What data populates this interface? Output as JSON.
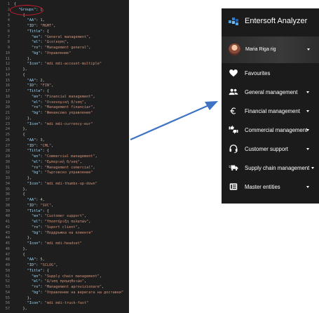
{
  "editor": {
    "lines": [
      {
        "n": "1",
        "parts": [
          [
            "p",
            "{"
          ]
        ]
      },
      {
        "n": "2",
        "parts": [
          [
            "p",
            "  "
          ],
          [
            "k",
            "\"Groups\""
          ],
          [
            "p",
            ": ["
          ]
        ]
      },
      {
        "n": "3",
        "parts": [
          [
            "p",
            "    {"
          ]
        ]
      },
      {
        "n": "4",
        "parts": [
          [
            "p",
            "      "
          ],
          [
            "k",
            "\"AA\""
          ],
          [
            "p",
            ": "
          ],
          [
            "n",
            "1"
          ],
          [
            "p",
            ","
          ]
        ]
      },
      {
        "n": "5",
        "parts": [
          [
            "p",
            "      "
          ],
          [
            "k",
            "\"ID\""
          ],
          [
            "p",
            ": "
          ],
          [
            "s",
            "\"MGMT\""
          ],
          [
            "p",
            ","
          ]
        ]
      },
      {
        "n": "6",
        "parts": [
          [
            "p",
            "      "
          ],
          [
            "k",
            "\"Title\""
          ],
          [
            "p",
            ": {"
          ]
        ]
      },
      {
        "n": "7",
        "parts": [
          [
            "p",
            "        "
          ],
          [
            "k",
            "\"en\""
          ],
          [
            "p",
            ": "
          ],
          [
            "s",
            "\"General management\""
          ],
          [
            "p",
            ","
          ]
        ]
      },
      {
        "n": "8",
        "parts": [
          [
            "p",
            "        "
          ],
          [
            "k",
            "\"el\""
          ],
          [
            "p",
            ": "
          ],
          [
            "s",
            "\"Διοίκηση\""
          ],
          [
            "p",
            ","
          ]
        ]
      },
      {
        "n": "9",
        "parts": [
          [
            "p",
            "        "
          ],
          [
            "k",
            "\"ro\""
          ],
          [
            "p",
            ": "
          ],
          [
            "s",
            "\"Management general\""
          ],
          [
            "p",
            ","
          ]
        ]
      },
      {
        "n": "10",
        "parts": [
          [
            "p",
            "        "
          ],
          [
            "k",
            "\"bg\""
          ],
          [
            "p",
            ": "
          ],
          [
            "s",
            "\"Управление\""
          ]
        ]
      },
      {
        "n": "11",
        "parts": [
          [
            "p",
            "      },"
          ]
        ]
      },
      {
        "n": "12",
        "parts": [
          [
            "p",
            "      "
          ],
          [
            "k",
            "\"Icon\""
          ],
          [
            "p",
            ": "
          ],
          [
            "s",
            "\"mdi mdi-account-multiple\""
          ]
        ]
      },
      {
        "n": "13",
        "parts": [
          [
            "p",
            "    },"
          ]
        ]
      },
      {
        "n": "14",
        "parts": [
          [
            "p",
            "    {"
          ]
        ]
      },
      {
        "n": "15",
        "parts": [
          [
            "p",
            "      "
          ],
          [
            "k",
            "\"AA\""
          ],
          [
            "p",
            ": "
          ],
          [
            "n",
            "2"
          ],
          [
            "p",
            ","
          ]
        ]
      },
      {
        "n": "16",
        "parts": [
          [
            "p",
            "      "
          ],
          [
            "k",
            "\"ID\""
          ],
          [
            "p",
            ": "
          ],
          [
            "s",
            "\"FIN\""
          ],
          [
            "p",
            ","
          ]
        ]
      },
      {
        "n": "17",
        "parts": [
          [
            "p",
            "      "
          ],
          [
            "k",
            "\"Title\""
          ],
          [
            "p",
            ": {"
          ]
        ]
      },
      {
        "n": "18",
        "parts": [
          [
            "p",
            "        "
          ],
          [
            "k",
            "\"en\""
          ],
          [
            "p",
            ": "
          ],
          [
            "s",
            "\"Financial management\""
          ],
          [
            "p",
            ","
          ]
        ]
      },
      {
        "n": "19",
        "parts": [
          [
            "p",
            "        "
          ],
          [
            "k",
            "\"el\""
          ],
          [
            "p",
            ": "
          ],
          [
            "s",
            "\"Οικονομική δ/νση\""
          ],
          [
            "p",
            ","
          ]
        ]
      },
      {
        "n": "20",
        "parts": [
          [
            "p",
            "        "
          ],
          [
            "k",
            "\"ro\""
          ],
          [
            "p",
            ": "
          ],
          [
            "s",
            "\"Management financiar\""
          ],
          [
            "p",
            ","
          ]
        ]
      },
      {
        "n": "21",
        "parts": [
          [
            "p",
            "        "
          ],
          [
            "k",
            "\"bg\""
          ],
          [
            "p",
            ": "
          ],
          [
            "s",
            "\"Финансово управление\""
          ]
        ]
      },
      {
        "n": "22",
        "parts": [
          [
            "p",
            "      },"
          ]
        ]
      },
      {
        "n": "23",
        "parts": [
          [
            "p",
            "      "
          ],
          [
            "k",
            "\"Icon\""
          ],
          [
            "p",
            ": "
          ],
          [
            "s",
            "\"mdi mdi-currency-eur\""
          ]
        ]
      },
      {
        "n": "24",
        "parts": [
          [
            "p",
            "    },"
          ]
        ]
      },
      {
        "n": "25",
        "parts": [
          [
            "p",
            "    {"
          ]
        ]
      },
      {
        "n": "26",
        "parts": [
          [
            "p",
            "      "
          ],
          [
            "k",
            "\"AA\""
          ],
          [
            "p",
            ": "
          ],
          [
            "n",
            "3"
          ],
          [
            "p",
            ","
          ]
        ]
      },
      {
        "n": "27",
        "parts": [
          [
            "p",
            "      "
          ],
          [
            "k",
            "\"ID\""
          ],
          [
            "p",
            ": "
          ],
          [
            "s",
            "\"CML\""
          ],
          [
            "p",
            ","
          ]
        ]
      },
      {
        "n": "28",
        "parts": [
          [
            "p",
            "      "
          ],
          [
            "k",
            "\"Title\""
          ],
          [
            "p",
            ": {"
          ]
        ]
      },
      {
        "n": "29",
        "parts": [
          [
            "p",
            "        "
          ],
          [
            "k",
            "\"en\""
          ],
          [
            "p",
            ": "
          ],
          [
            "s",
            "\"Commercial management\""
          ],
          [
            "p",
            ","
          ]
        ]
      },
      {
        "n": "30",
        "parts": [
          [
            "p",
            "        "
          ],
          [
            "k",
            "\"el\""
          ],
          [
            "p",
            ": "
          ],
          [
            "s",
            "\"Εμπορική δ/νση\""
          ],
          [
            "p",
            ","
          ]
        ]
      },
      {
        "n": "31",
        "parts": [
          [
            "p",
            "        "
          ],
          [
            "k",
            "\"ro\""
          ],
          [
            "p",
            ": "
          ],
          [
            "s",
            "\"Management comercial\""
          ],
          [
            "p",
            ","
          ]
        ]
      },
      {
        "n": "32",
        "parts": [
          [
            "p",
            "        "
          ],
          [
            "k",
            "\"bg\""
          ],
          [
            "p",
            ": "
          ],
          [
            "s",
            "\"Търговско управление\""
          ]
        ]
      },
      {
        "n": "33",
        "parts": [
          [
            "p",
            "      },"
          ]
        ]
      },
      {
        "n": "34",
        "parts": [
          [
            "p",
            "      "
          ],
          [
            "k",
            "\"Icon\""
          ],
          [
            "p",
            ": "
          ],
          [
            "s",
            "\"mdi mdi-thumbs-up-down\""
          ]
        ]
      },
      {
        "n": "35",
        "parts": [
          [
            "p",
            "    },"
          ]
        ]
      },
      {
        "n": "36",
        "parts": [
          [
            "p",
            "    {"
          ]
        ]
      },
      {
        "n": "37",
        "parts": [
          [
            "p",
            "      "
          ],
          [
            "k",
            "\"AA\""
          ],
          [
            "p",
            ": "
          ],
          [
            "n",
            "4"
          ],
          [
            "p",
            ","
          ]
        ]
      },
      {
        "n": "38",
        "parts": [
          [
            "p",
            "      "
          ],
          [
            "k",
            "\"ID\""
          ],
          [
            "p",
            ": "
          ],
          [
            "s",
            "\"SVC\""
          ],
          [
            "p",
            ","
          ]
        ]
      },
      {
        "n": "39",
        "parts": [
          [
            "p",
            "      "
          ],
          [
            "k",
            "\"Title\""
          ],
          [
            "p",
            ": {"
          ]
        ]
      },
      {
        "n": "40",
        "parts": [
          [
            "p",
            "        "
          ],
          [
            "k",
            "\"en\""
          ],
          [
            "p",
            ": "
          ],
          [
            "s",
            "\"Customer support\""
          ],
          [
            "p",
            ","
          ]
        ]
      },
      {
        "n": "41",
        "parts": [
          [
            "p",
            "        "
          ],
          [
            "k",
            "\"el\""
          ],
          [
            "p",
            ": "
          ],
          [
            "s",
            "\"Υποστήριξη πελατών\""
          ],
          [
            "p",
            ","
          ]
        ]
      },
      {
        "n": "42",
        "parts": [
          [
            "p",
            "        "
          ],
          [
            "k",
            "\"ro\""
          ],
          [
            "p",
            ": "
          ],
          [
            "s",
            "\"Suport client\""
          ],
          [
            "p",
            ","
          ]
        ]
      },
      {
        "n": "43",
        "parts": [
          [
            "p",
            "        "
          ],
          [
            "k",
            "\"bg\""
          ],
          [
            "p",
            ": "
          ],
          [
            "s",
            "\"Поддръжка на клиенти\""
          ]
        ]
      },
      {
        "n": "44",
        "parts": [
          [
            "p",
            "      },"
          ]
        ]
      },
      {
        "n": "45",
        "parts": [
          [
            "p",
            "      "
          ],
          [
            "k",
            "\"Icon\""
          ],
          [
            "p",
            ": "
          ],
          [
            "s",
            "\"mdi mdi-headset\""
          ]
        ]
      },
      {
        "n": "46",
        "parts": [
          [
            "p",
            "    },"
          ]
        ]
      },
      {
        "n": "47",
        "parts": [
          [
            "p",
            "    {"
          ]
        ]
      },
      {
        "n": "48",
        "parts": [
          [
            "p",
            "      "
          ],
          [
            "k",
            "\"AA\""
          ],
          [
            "p",
            ": "
          ],
          [
            "n",
            "5"
          ],
          [
            "p",
            ","
          ]
        ]
      },
      {
        "n": "49",
        "parts": [
          [
            "p",
            "      "
          ],
          [
            "k",
            "\"ID\""
          ],
          [
            "p",
            ": "
          ],
          [
            "s",
            "\"SCLOG\""
          ],
          [
            "p",
            ","
          ]
        ]
      },
      {
        "n": "50",
        "parts": [
          [
            "p",
            "      "
          ],
          [
            "k",
            "\"Title\""
          ],
          [
            "p",
            ": {"
          ]
        ]
      },
      {
        "n": "51",
        "parts": [
          [
            "p",
            "        "
          ],
          [
            "k",
            "\"en\""
          ],
          [
            "p",
            ": "
          ],
          [
            "s",
            "\"Supply chain management\""
          ],
          [
            "p",
            ","
          ]
        ]
      },
      {
        "n": "52",
        "parts": [
          [
            "p",
            "        "
          ],
          [
            "k",
            "\"el\""
          ],
          [
            "p",
            ": "
          ],
          [
            "s",
            "\"Δ/νση προμηθειών\""
          ],
          [
            "p",
            ","
          ]
        ]
      },
      {
        "n": "53",
        "parts": [
          [
            "p",
            "        "
          ],
          [
            "k",
            "\"ro\""
          ],
          [
            "p",
            ": "
          ],
          [
            "s",
            "\"Management aprovizionare\""
          ],
          [
            "p",
            ","
          ]
        ]
      },
      {
        "n": "54",
        "parts": [
          [
            "p",
            "        "
          ],
          [
            "k",
            "\"bg\""
          ],
          [
            "p",
            ": "
          ],
          [
            "s",
            "\"Управление на веригата на доставки\""
          ]
        ]
      },
      {
        "n": "55",
        "parts": [
          [
            "p",
            "      },"
          ]
        ]
      },
      {
        "n": "56",
        "parts": [
          [
            "p",
            "      "
          ],
          [
            "k",
            "\"Icon\""
          ],
          [
            "p",
            ": "
          ],
          [
            "s",
            "\"mdi mdi-truck-fast\""
          ]
        ]
      },
      {
        "n": "57",
        "parts": [
          [
            "p",
            "    },"
          ]
        ]
      }
    ],
    "highlight_color": "#d11a2a"
  },
  "sidebar": {
    "app_title": "Entersoft Analyzer",
    "user_name": "Maria Riga rig",
    "items": [
      {
        "label": "Favourites",
        "icon": "heart-icon",
        "has_caret": false
      },
      {
        "label": "General management",
        "icon": "account-multiple-icon",
        "has_caret": true
      },
      {
        "label": "Financial management",
        "icon": "currency-eur-icon",
        "has_caret": true
      },
      {
        "label": "Commercial management",
        "icon": "thumbs-up-down-icon",
        "has_caret": true
      },
      {
        "label": "Customer support",
        "icon": "headset-icon",
        "has_caret": true
      },
      {
        "label": "Supply chain management",
        "icon": "truck-fast-icon",
        "has_caret": true
      },
      {
        "label": "Master entities",
        "icon": "database-icon",
        "has_caret": true
      }
    ]
  },
  "colors": {
    "editor_bg": "#1e1e1e",
    "sidebar_bg": "#1b1b1b",
    "arrow": "#3f73c4",
    "key": "#9cdcfe",
    "string": "#ce9178",
    "number": "#b5cea8"
  }
}
